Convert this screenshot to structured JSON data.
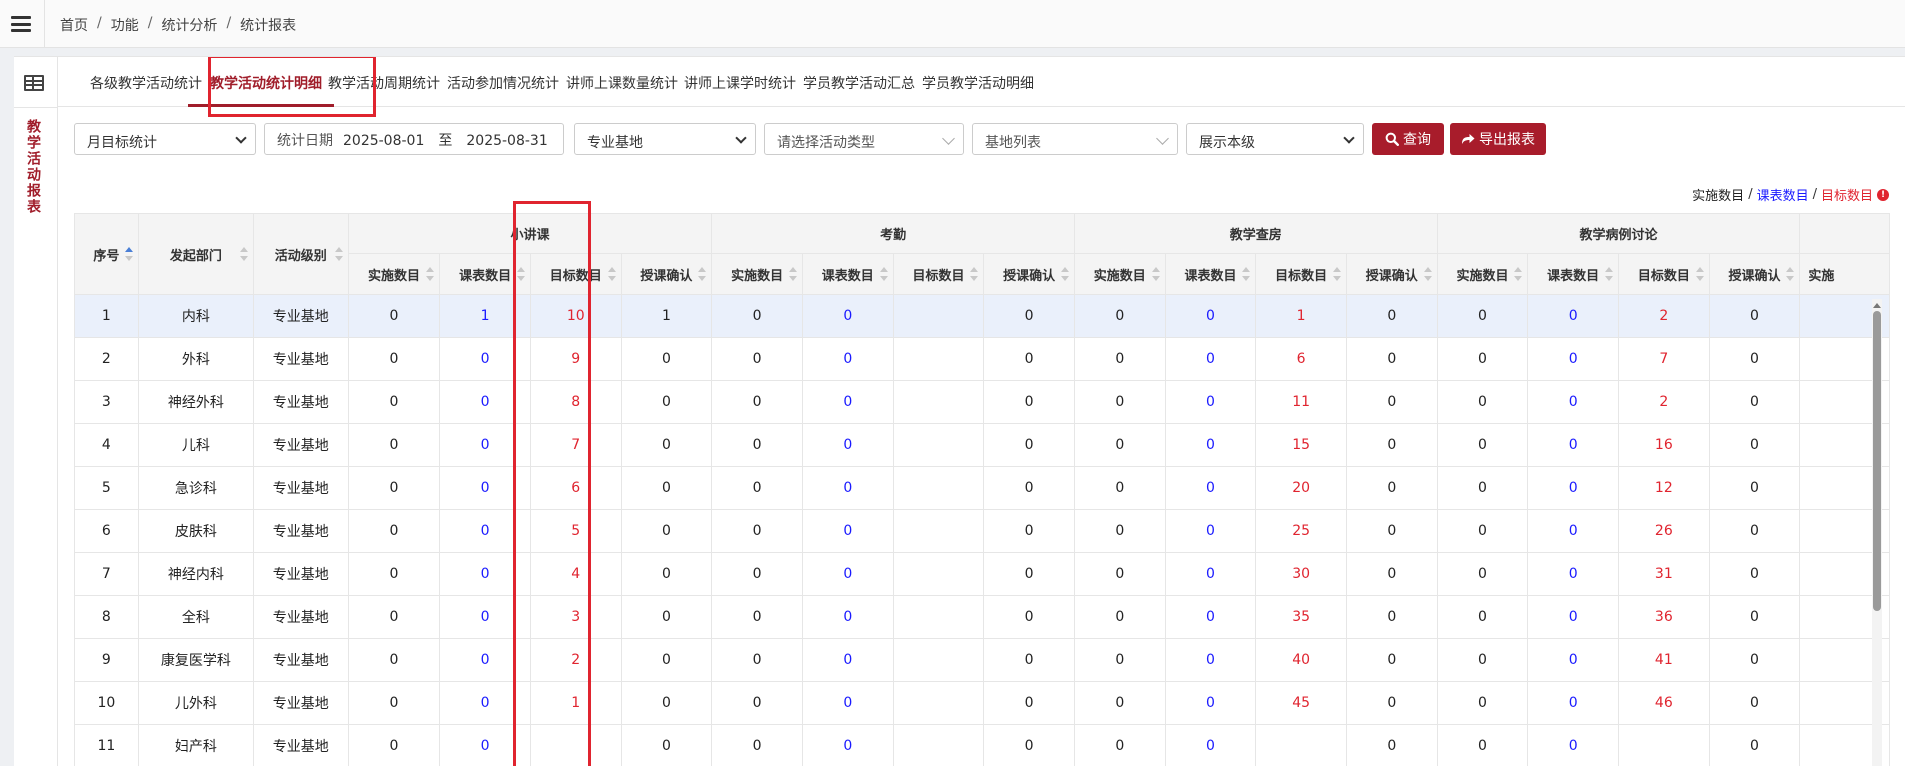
{
  "breadcrumb": [
    "首页",
    "功能",
    "统计分析",
    "统计报表"
  ],
  "side_title": "教学活动报表",
  "tabs": [
    {
      "label": "各级教学活动统计",
      "active": false
    },
    {
      "label": "教学活动统计明细",
      "active": true
    },
    {
      "label": "教学活动周期统计",
      "active": false
    },
    {
      "label": "活动参加情况统计",
      "active": false
    },
    {
      "label": "讲师上课数量统计",
      "active": false
    },
    {
      "label": "讲师上课学时统计",
      "active": false
    },
    {
      "label": "学员教学活动汇总",
      "active": false
    },
    {
      "label": "学员教学活动明细",
      "active": false
    }
  ],
  "filters": {
    "stat_type": "月目标统计",
    "date_label": "统计日期",
    "date_start": "2025-08-01",
    "date_to": "至",
    "date_end": "2025-08-31",
    "base_type": "专业基地",
    "activity_type_placeholder": "请选择活动类型",
    "base_list_placeholder": "基地列表",
    "display_level": "展示本级",
    "query_label": "查询",
    "export_label": "导出报表"
  },
  "legend": {
    "actual": "实施数目",
    "schedule": "课表数目",
    "target": "目标数目",
    "sep": "/"
  },
  "colors": {
    "accent": "#a81c2b",
    "blue": "#1a1aff",
    "red": "#e0242f",
    "highlight": "#e0242f"
  },
  "table": {
    "fixed_headers": [
      "序号",
      "发起部门",
      "活动级别"
    ],
    "groups": [
      "小讲课",
      "考勤",
      "教学查房",
      "教学病例讨论"
    ],
    "sub_headers": [
      "实施数目",
      "课表数目",
      "目标数目",
      "授课确认"
    ],
    "overflow_header": "实施",
    "rows": [
      {
        "no": "1",
        "dept": "内科",
        "level": "专业基地",
        "g": [
          [
            "0",
            "1",
            "10",
            "1"
          ],
          [
            "0",
            "0",
            "",
            "0"
          ],
          [
            "0",
            "0",
            "1",
            "0"
          ],
          [
            "0",
            "0",
            "2",
            "0"
          ]
        ]
      },
      {
        "no": "2",
        "dept": "外科",
        "level": "专业基地",
        "g": [
          [
            "0",
            "0",
            "9",
            "0"
          ],
          [
            "0",
            "0",
            "",
            "0"
          ],
          [
            "0",
            "0",
            "6",
            "0"
          ],
          [
            "0",
            "0",
            "7",
            "0"
          ]
        ]
      },
      {
        "no": "3",
        "dept": "神经外科",
        "level": "专业基地",
        "g": [
          [
            "0",
            "0",
            "8",
            "0"
          ],
          [
            "0",
            "0",
            "",
            "0"
          ],
          [
            "0",
            "0",
            "11",
            "0"
          ],
          [
            "0",
            "0",
            "2",
            "0"
          ]
        ]
      },
      {
        "no": "4",
        "dept": "儿科",
        "level": "专业基地",
        "g": [
          [
            "0",
            "0",
            "7",
            "0"
          ],
          [
            "0",
            "0",
            "",
            "0"
          ],
          [
            "0",
            "0",
            "15",
            "0"
          ],
          [
            "0",
            "0",
            "16",
            "0"
          ]
        ]
      },
      {
        "no": "5",
        "dept": "急诊科",
        "level": "专业基地",
        "g": [
          [
            "0",
            "0",
            "6",
            "0"
          ],
          [
            "0",
            "0",
            "",
            "0"
          ],
          [
            "0",
            "0",
            "20",
            "0"
          ],
          [
            "0",
            "0",
            "12",
            "0"
          ]
        ]
      },
      {
        "no": "6",
        "dept": "皮肤科",
        "level": "专业基地",
        "g": [
          [
            "0",
            "0",
            "5",
            "0"
          ],
          [
            "0",
            "0",
            "",
            "0"
          ],
          [
            "0",
            "0",
            "25",
            "0"
          ],
          [
            "0",
            "0",
            "26",
            "0"
          ]
        ]
      },
      {
        "no": "7",
        "dept": "神经内科",
        "level": "专业基地",
        "g": [
          [
            "0",
            "0",
            "4",
            "0"
          ],
          [
            "0",
            "0",
            "",
            "0"
          ],
          [
            "0",
            "0",
            "30",
            "0"
          ],
          [
            "0",
            "0",
            "31",
            "0"
          ]
        ]
      },
      {
        "no": "8",
        "dept": "全科",
        "level": "专业基地",
        "g": [
          [
            "0",
            "0",
            "3",
            "0"
          ],
          [
            "0",
            "0",
            "",
            "0"
          ],
          [
            "0",
            "0",
            "35",
            "0"
          ],
          [
            "0",
            "0",
            "36",
            "0"
          ]
        ]
      },
      {
        "no": "9",
        "dept": "康复医学科",
        "level": "专业基地",
        "g": [
          [
            "0",
            "0",
            "2",
            "0"
          ],
          [
            "0",
            "0",
            "",
            "0"
          ],
          [
            "0",
            "0",
            "40",
            "0"
          ],
          [
            "0",
            "0",
            "41",
            "0"
          ]
        ]
      },
      {
        "no": "10",
        "dept": "儿外科",
        "level": "专业基地",
        "g": [
          [
            "0",
            "0",
            "1",
            "0"
          ],
          [
            "0",
            "0",
            "",
            "0"
          ],
          [
            "0",
            "0",
            "45",
            "0"
          ],
          [
            "0",
            "0",
            "46",
            "0"
          ]
        ]
      },
      {
        "no": "11",
        "dept": "妇产科",
        "level": "专业基地",
        "g": [
          [
            "0",
            "0",
            "",
            "0"
          ],
          [
            "0",
            "0",
            "",
            "0"
          ],
          [
            "0",
            "0",
            "",
            "0"
          ],
          [
            "0",
            "0",
            "",
            "0"
          ]
        ]
      }
    ]
  }
}
